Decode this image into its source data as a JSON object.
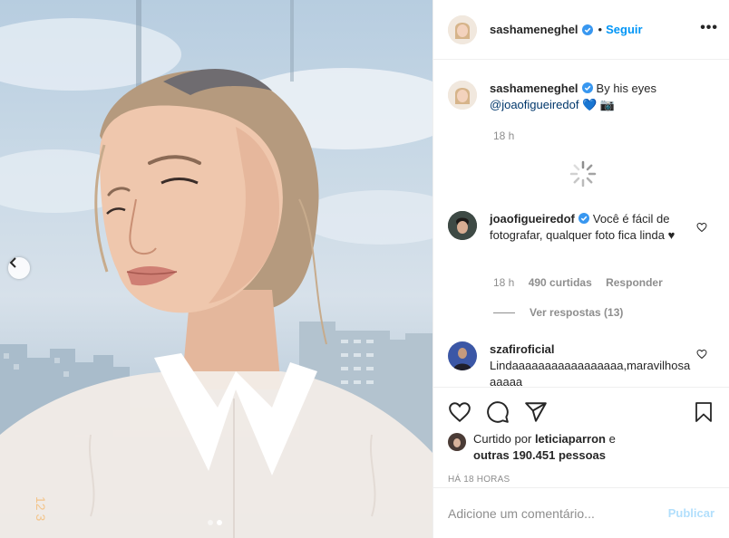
{
  "post": {
    "author": "sashameneghel",
    "follow_label": "Seguir",
    "separator": "•",
    "more_label": "•••",
    "photo_alt": "Portrait photo",
    "photo_timestamp_text": "12 3",
    "carousel": {
      "count": 2,
      "active_index": 1
    }
  },
  "caption": {
    "username": "sashameneghel",
    "text": "By his eyes",
    "mention": "@joaofigueiredof",
    "emoji": "💙 📷",
    "time": "18 h"
  },
  "comments": [
    {
      "username": "joaofigueiredof",
      "text": "Você é fácil de fotografar, qualquer foto fica linda ♥",
      "time": "18 h",
      "likes": "490 curtidas",
      "reply_label": "Responder",
      "view_replies": "Ver respostas (13)"
    },
    {
      "username": "szafiroficial",
      "text": "Lindaaaaaaaaaaaaaaaaa,maravilhosaaaaaa"
    }
  ],
  "likes": {
    "prefix": "Curtido por",
    "first_user": "leticiaparron",
    "conj": "e",
    "others": "outras 190.451 pessoas"
  },
  "time_ago": "HÁ 18 HORAS",
  "add_comment": {
    "placeholder": "Adicione um comentário...",
    "publish_label": "Publicar"
  },
  "colors": {
    "accent": "#0095f6",
    "verified": "#3897f0",
    "publish_disabled": "#b2dffc"
  }
}
